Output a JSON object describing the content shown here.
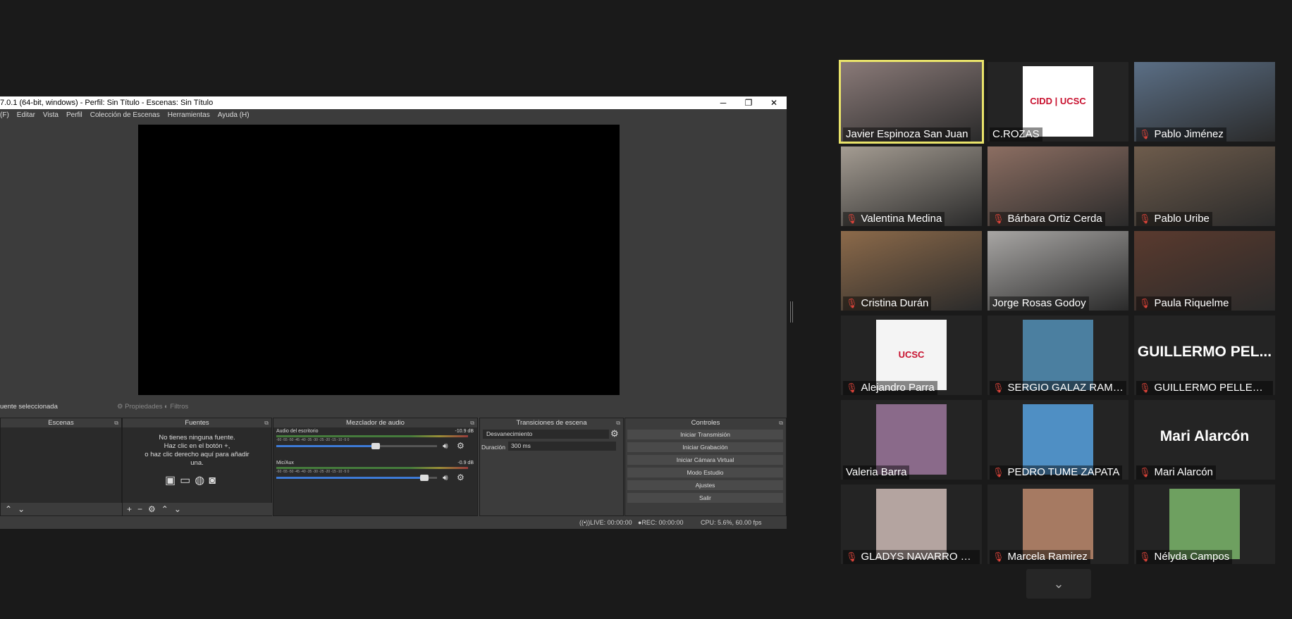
{
  "obs": {
    "title": "7.0.1 (64-bit, windows) - Perfil: Sin Título - Escenas: Sin Título",
    "window_buttons": [
      "─",
      "❐",
      "✕"
    ],
    "menu": [
      "(F)",
      "Editar",
      "Vista",
      "Perfil",
      "Colección de Escenas",
      "Herramientas",
      "Ayuda (H)"
    ],
    "source_bar": {
      "no_source": "uente seleccionada",
      "properties": "Propiedades",
      "filters": "Filtros"
    },
    "docks": {
      "scenes": {
        "title": "Escenas"
      },
      "sources": {
        "title": "Fuentes",
        "empty_line1": "No tienes ninguna fuente.",
        "empty_line2": "Haz clic en el botón +,",
        "empty_line3": "o haz clic derecho aquí para añadir",
        "empty_line4": "una."
      },
      "mixer": {
        "title": "Mezclador de audio",
        "channels": [
          {
            "name": "Audio del escritorio",
            "db": "-10.9 dB",
            "volume": 0.62
          },
          {
            "name": "Mic/Aux",
            "db": "-0.9 dB",
            "volume": 0.92
          }
        ],
        "scale": "-60 -55 -50 -45 -40 -35 -30 -25 -20 -15 -10 -5 0"
      },
      "transitions": {
        "title": "Transiciones de escena",
        "selected": "Desvanecimiento",
        "duration_label": "Duración",
        "duration_value": "300 ms"
      },
      "controls": {
        "title": "Controles",
        "buttons": [
          "Iniciar Transmisión",
          "Iniciar Grabación",
          "Iniciar Cámara Virtual",
          "Modo Estudio",
          "Ajustes",
          "Salir"
        ]
      }
    },
    "status": {
      "live": "LIVE: 00:00:00",
      "rec": "REC: 00:00:00",
      "cpu": "CPU: 5.6%, 60.00 fps"
    }
  },
  "participants": [
    {
      "name": "Javier Espinoza San Juan",
      "muted": false,
      "active": true,
      "video": "#8a7a78"
    },
    {
      "name": "C.ROZAS",
      "muted": false,
      "active": false,
      "logo": "CIDD | UCSC",
      "video": "#ffffff"
    },
    {
      "name": "Pablo Jiménez",
      "muted": true,
      "active": false,
      "video": "#5b6f86"
    },
    {
      "name": "Valentina Medina",
      "muted": true,
      "active": false,
      "video": "#a49c92"
    },
    {
      "name": "Bárbara Ortiz Cerda",
      "muted": true,
      "active": false,
      "video": "#8c6e62"
    },
    {
      "name": "Pablo Uribe",
      "muted": true,
      "active": false,
      "video": "#6e5c4c"
    },
    {
      "name": "Cristina Durán",
      "muted": true,
      "active": false,
      "video": "#8c6a4a"
    },
    {
      "name": "Jorge Rosas Godoy",
      "muted": false,
      "active": false,
      "video": "#a8a6a4"
    },
    {
      "name": "Paula Riquelme",
      "muted": true,
      "active": false,
      "video": "#5a3a2e"
    },
    {
      "name": "Alejandro Parra",
      "muted": true,
      "active": false,
      "logo": "UCSC",
      "video": "#f4f4f4"
    },
    {
      "name": "SERGIO GALAZ RAMÍREZ",
      "muted": true,
      "active": false,
      "video": "#4b7fa0"
    },
    {
      "name": "GUILLERMO PELLERANO",
      "muted": true,
      "active": false,
      "bigtext": "GUILLERMO PEL...",
      "video": ""
    },
    {
      "name": "Valeria Barra",
      "muted": false,
      "active": false,
      "video": "#8a6a8a"
    },
    {
      "name": "PEDRO TUME ZAPATA",
      "muted": true,
      "active": false,
      "video": "#4f8fc4"
    },
    {
      "name": "Mari Alarcón",
      "muted": true,
      "active": false,
      "bigtext": "Mari Alarcón",
      "video": ""
    },
    {
      "name": "GLADYS NAVARRO VE...",
      "muted": true,
      "active": false,
      "video": "#b4a4a0"
    },
    {
      "name": "Marcela Ramirez",
      "muted": true,
      "active": false,
      "video": "#a67a62"
    },
    {
      "name": "Nélyda Campos",
      "muted": true,
      "active": false,
      "video": "#6ea060"
    }
  ],
  "icons": {
    "mic_muted": "mic-muted-icon",
    "scroll_down": "chevron-down-icon"
  }
}
